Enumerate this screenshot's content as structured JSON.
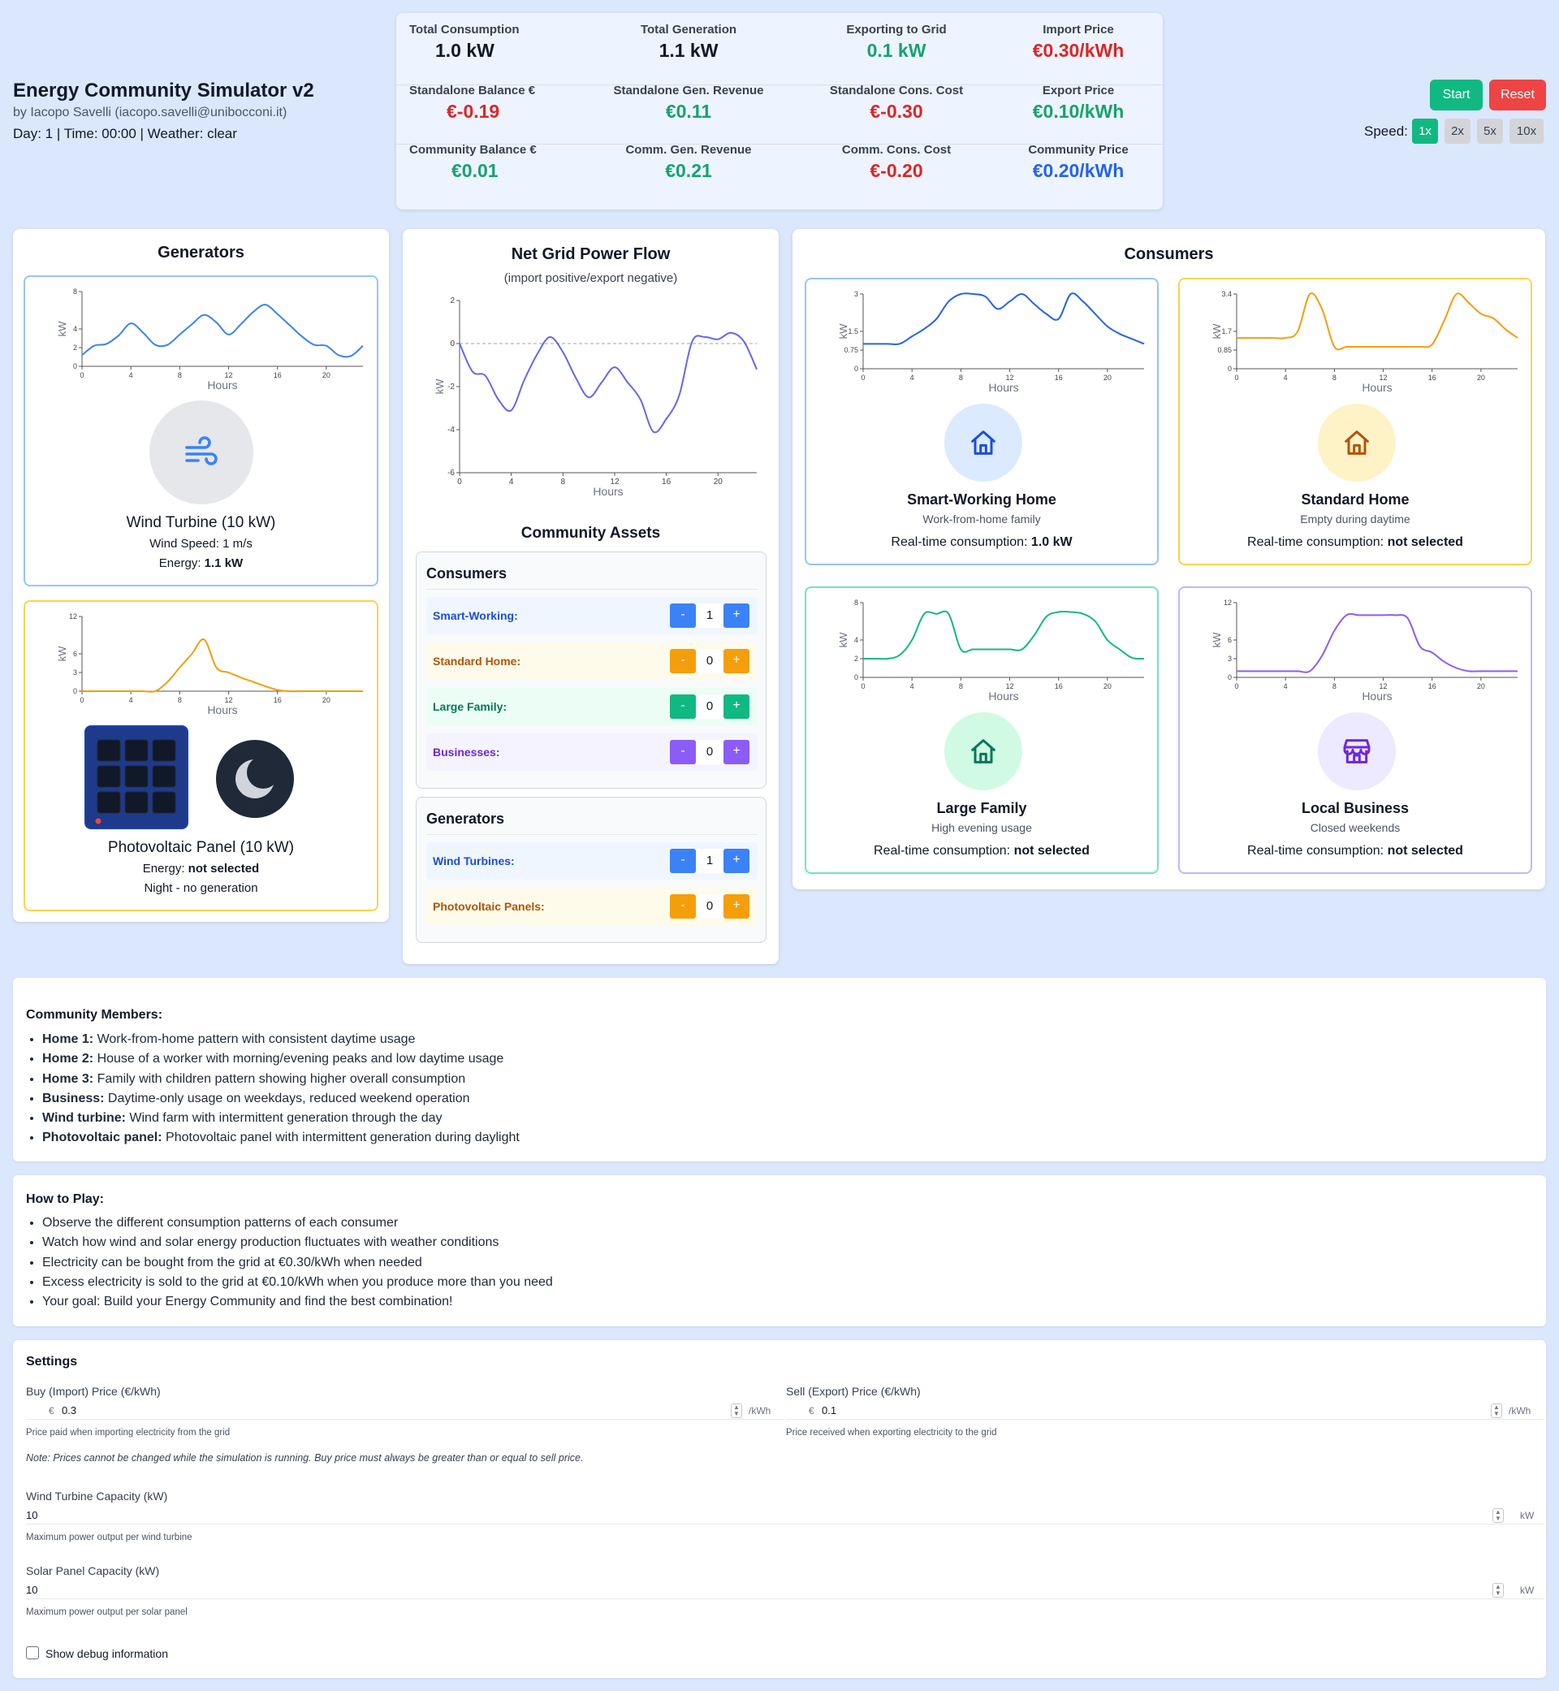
{
  "header": {
    "title": "Energy Community Simulator v2",
    "author": "by Iacopo Savelli (iacopo.savelli@unibocconi.it)",
    "status": "Day: 1 | Time: 00:00 | Weather: clear",
    "start_label": "Start",
    "reset_label": "Reset",
    "speed_label": "Speed:",
    "speeds": [
      "1x",
      "2x",
      "5x",
      "10x"
    ],
    "active_speed": "1x"
  },
  "stats": {
    "total_consumption": {
      "label": "Total Consumption",
      "value": "1.0 kW"
    },
    "total_generation": {
      "label": "Total Generation",
      "value": "1.1 kW"
    },
    "exporting": {
      "label": "Exporting to Grid",
      "value": "0.1 kW"
    },
    "import_price": {
      "label": "Import Price",
      "value": "€0.30/kWh"
    },
    "standalone_balance": {
      "label": "Standalone Balance €",
      "value": "€-0.19"
    },
    "standalone_gen_rev": {
      "label": "Standalone Gen. Revenue",
      "value": "€0.11"
    },
    "standalone_cons_cost": {
      "label": "Standalone Cons. Cost",
      "value": "€-0.30"
    },
    "export_price": {
      "label": "Export Price",
      "value": "€0.10/kWh"
    },
    "community_balance": {
      "label": "Community Balance €",
      "value": "€0.01"
    },
    "comm_gen_rev": {
      "label": "Comm. Gen. Revenue",
      "value": "€0.21"
    },
    "comm_cons_cost": {
      "label": "Comm. Cons. Cost",
      "value": "€-0.20"
    },
    "community_price": {
      "label": "Community Price",
      "value": "€0.20/kWh"
    }
  },
  "generators": {
    "title": "Generators",
    "wind": {
      "name": "Wind Turbine (10 kW)",
      "speed": "Wind Speed: 1 m/s",
      "energy_label": "Energy:",
      "energy_value": "1.1 kW"
    },
    "pv": {
      "name": "Photovoltaic Panel (10 kW)",
      "energy_label": "Energy:",
      "energy_value": "not selected",
      "note": "Night - no generation"
    }
  },
  "grid": {
    "title": "Net Grid Power Flow",
    "subtitle": "(import positive/export negative)"
  },
  "assets": {
    "title": "Community Assets",
    "consumers_title": "Consumers",
    "consumers": [
      {
        "label": "Smart-Working:",
        "count": "1",
        "color": "#3b82f6",
        "bg": "#eff6ff",
        "text": "#1d4ed8"
      },
      {
        "label": "Standard Home:",
        "count": "0",
        "color": "#f59e0b",
        "bg": "#fffbeb",
        "text": "#b45309"
      },
      {
        "label": "Large Family:",
        "count": "0",
        "color": "#10b981",
        "bg": "#ecfdf5",
        "text": "#047857"
      },
      {
        "label": "Businesses:",
        "count": "0",
        "color": "#8b5cf6",
        "bg": "#f5f3ff",
        "text": "#6d28d9"
      }
    ],
    "generators_title": "Generators",
    "generators": [
      {
        "label": "Wind Turbines:",
        "count": "1",
        "color": "#3b82f6",
        "bg": "#eff6ff",
        "text": "#1d4ed8"
      },
      {
        "label": "Photovoltaic Panels:",
        "count": "0",
        "color": "#f59e0b",
        "bg": "#fffbeb",
        "text": "#b45309"
      }
    ],
    "minus": "-",
    "plus": "+"
  },
  "consumers": {
    "title": "Consumers",
    "real_label": "Real-time consumption:",
    "cards": [
      {
        "name": "Smart-Working Home",
        "desc": "Work-from-home family",
        "value": "1.0 kW",
        "icon": "home-icon"
      },
      {
        "name": "Standard Home",
        "desc": "Empty during daytime",
        "value": "not selected",
        "icon": "home-icon"
      },
      {
        "name": "Large Family",
        "desc": "High evening usage",
        "value": "not selected",
        "icon": "home-icon"
      },
      {
        "name": "Local Business",
        "desc": "Closed weekends",
        "value": "not selected",
        "icon": "store-icon"
      }
    ]
  },
  "members": {
    "title": "Community Members:",
    "items": [
      {
        "k": "Home 1:",
        "v": " Work-from-home pattern with consistent daytime usage"
      },
      {
        "k": "Home 2:",
        "v": " House of a worker with morning/evening peaks and low daytime usage"
      },
      {
        "k": "Home 3:",
        "v": " Family with children pattern showing higher overall consumption"
      },
      {
        "k": "Business:",
        "v": " Daytime-only usage on weekdays, reduced weekend operation"
      },
      {
        "k": "Wind turbine:",
        "v": " Wind farm with intermittent generation through the day"
      },
      {
        "k": "Photovoltaic panel:",
        "v": " Photovoltaic panel with intermittent generation during daylight"
      }
    ]
  },
  "howto": {
    "title": "How to Play:",
    "items": [
      "Observe the different consumption patterns of each consumer",
      "Watch how wind and solar energy production fluctuates with weather conditions",
      "Electricity can be bought from the grid at €0.30/kWh when needed",
      "Excess electricity is sold to the grid at €0.10/kWh when you produce more than you need",
      "Your goal: Build your Energy Community and find the best combination!"
    ]
  },
  "settings": {
    "title": "Settings",
    "buy_label": "Buy (Import) Price (€/kWh)",
    "buy_value": "0.3",
    "buy_help": "Price paid when importing electricity from the grid",
    "sell_label": "Sell (Export) Price (€/kWh)",
    "sell_value": "0.1",
    "sell_help": "Price received when exporting electricity to the grid",
    "currency": "€",
    "unit_kwh": "/kWh",
    "note": "Note: Prices cannot be changed while the simulation is running. Buy price must always be greater than or equal to sell price.",
    "wind_label": "Wind Turbine Capacity (kW)",
    "wind_value": "10",
    "wind_help": "Maximum power output per wind turbine",
    "solar_label": "Solar Panel Capacity (kW)",
    "solar_value": "10",
    "solar_help": "Maximum power output per solar panel",
    "unit_kw": "kW",
    "debug_label": "Show debug information"
  },
  "chart_data": [
    {
      "id": "wind",
      "type": "line",
      "color": "#3b82f6",
      "ylabel": "kW",
      "xlabel": "Hours",
      "xlim": [
        0,
        23
      ],
      "ylim": [
        0,
        8
      ],
      "yticks": [
        0,
        2,
        4,
        8
      ],
      "xticks": [
        0,
        4,
        8,
        12,
        16,
        20
      ],
      "x": [
        0,
        1,
        2,
        3,
        4,
        5,
        6,
        7,
        8,
        9,
        10,
        11,
        12,
        13,
        14,
        15,
        16,
        17,
        18,
        19,
        20,
        21,
        22,
        23
      ],
      "y": [
        1.2,
        2.2,
        2.4,
        3.3,
        4.6,
        3.6,
        2.3,
        2.3,
        3.4,
        4.5,
        5.5,
        4.7,
        3.4,
        4.5,
        5.8,
        6.6,
        5.6,
        4.4,
        3.2,
        2.3,
        2.2,
        1.2,
        1.1,
        2.2
      ]
    },
    {
      "id": "pv",
      "type": "line",
      "color": "#f59e0b",
      "ylabel": "kW",
      "xlabel": "Hours",
      "xlim": [
        0,
        23
      ],
      "ylim": [
        0,
        12
      ],
      "yticks": [
        0,
        3,
        6,
        12
      ],
      "xticks": [
        0,
        4,
        8,
        12,
        16,
        20
      ],
      "x": [
        0,
        1,
        2,
        3,
        4,
        5,
        6,
        7,
        8,
        9,
        10,
        11,
        12,
        13,
        14,
        15,
        16,
        17,
        18,
        19,
        20,
        21,
        22,
        23
      ],
      "y": [
        0,
        0,
        0,
        0,
        0,
        0,
        0,
        1.5,
        3.8,
        6,
        8.3,
        3.8,
        3,
        2.2,
        1.5,
        0.8,
        0.2,
        0,
        0,
        0,
        0,
        0,
        0,
        0
      ]
    },
    {
      "id": "grid",
      "type": "line",
      "color": "#6366f1",
      "ylabel": "kW",
      "xlabel": "Hours",
      "xlim": [
        0,
        23
      ],
      "ylim": [
        -6,
        2
      ],
      "yticks": [
        -6,
        -4,
        -2,
        0,
        2
      ],
      "xticks": [
        0,
        4,
        8,
        12,
        16,
        20
      ],
      "zero_line": true,
      "x": [
        0,
        1,
        2,
        3,
        4,
        5,
        6,
        7,
        8,
        9,
        10,
        11,
        12,
        13,
        14,
        15,
        16,
        17,
        18,
        19,
        20,
        21,
        22,
        23
      ],
      "y": [
        0,
        -1.3,
        -1.5,
        -2.6,
        -3.1,
        -1.7,
        -0.5,
        0.3,
        -0.4,
        -1.6,
        -2.5,
        -1.8,
        -1.1,
        -1.8,
        -2.6,
        -4.1,
        -3.5,
        -2.4,
        0.1,
        0.3,
        0.2,
        0.5,
        0.1,
        -1.2
      ]
    },
    {
      "id": "smart",
      "type": "line",
      "color": "#2563eb",
      "ylabel": "kW",
      "xlabel": "Hours",
      "xlim": [
        0,
        23
      ],
      "ylim": [
        0,
        3
      ],
      "yticks": [
        0,
        0.75,
        1.5,
        3
      ],
      "xticks": [
        0,
        4,
        8,
        12,
        16,
        20
      ],
      "x": [
        0,
        1,
        2,
        3,
        4,
        5,
        6,
        7,
        8,
        9,
        10,
        11,
        12,
        13,
        14,
        15,
        16,
        17,
        18,
        19,
        20,
        21,
        22,
        23
      ],
      "y": [
        1,
        1,
        1,
        1,
        1.3,
        1.6,
        2,
        2.7,
        3,
        3,
        2.9,
        2.4,
        2.7,
        3,
        2.6,
        2.2,
        2,
        3,
        2.7,
        2.2,
        1.7,
        1.4,
        1.2,
        1
      ]
    },
    {
      "id": "standard",
      "type": "line",
      "color": "#f59e0b",
      "ylabel": "kW",
      "xlabel": "Hours",
      "xlim": [
        0,
        23
      ],
      "ylim": [
        0,
        3.4
      ],
      "yticks": [
        0,
        0.85,
        1.7,
        3.4
      ],
      "xticks": [
        0,
        4,
        8,
        12,
        16,
        20
      ],
      "x": [
        0,
        1,
        2,
        3,
        4,
        5,
        6,
        7,
        8,
        9,
        10,
        11,
        12,
        13,
        14,
        15,
        16,
        17,
        18,
        19,
        20,
        21,
        22,
        23
      ],
      "y": [
        1.4,
        1.4,
        1.4,
        1.4,
        1.4,
        1.7,
        3.4,
        2.7,
        1,
        1,
        1,
        1,
        1,
        1,
        1,
        1,
        1.1,
        2.2,
        3.4,
        3,
        2.5,
        2.3,
        1.8,
        1.4
      ]
    },
    {
      "id": "family",
      "type": "line",
      "color": "#10b981",
      "ylabel": "kW",
      "xlabel": "Hours",
      "xlim": [
        0,
        23
      ],
      "ylim": [
        0,
        8
      ],
      "yticks": [
        0,
        2,
        4,
        8
      ],
      "xticks": [
        0,
        4,
        8,
        12,
        16,
        20
      ],
      "x": [
        0,
        1,
        2,
        3,
        4,
        5,
        6,
        7,
        8,
        9,
        10,
        11,
        12,
        13,
        14,
        15,
        16,
        17,
        18,
        19,
        20,
        21,
        22,
        23
      ],
      "y": [
        2,
        2,
        2,
        2.4,
        4,
        6.8,
        6.8,
        6.8,
        3,
        3,
        3,
        3,
        3,
        3,
        4.5,
        6.5,
        7,
        7,
        6.8,
        6,
        4,
        3,
        2.1,
        2
      ]
    },
    {
      "id": "business",
      "type": "line",
      "color": "#8b5cf6",
      "ylabel": "kW",
      "xlabel": "Hours",
      "xlim": [
        0,
        23
      ],
      "ylim": [
        0,
        12
      ],
      "yticks": [
        0,
        3,
        6,
        12
      ],
      "xticks": [
        0,
        4,
        8,
        12,
        16,
        20
      ],
      "x": [
        0,
        1,
        2,
        3,
        4,
        5,
        6,
        7,
        8,
        9,
        10,
        11,
        12,
        13,
        14,
        15,
        16,
        17,
        18,
        19,
        20,
        21,
        22,
        23
      ],
      "y": [
        1,
        1,
        1,
        1,
        1,
        1,
        1,
        3.5,
        7.5,
        10,
        10,
        10,
        10,
        10,
        9.5,
        5,
        4,
        2.5,
        1.5,
        1,
        1,
        1,
        1,
        1
      ]
    }
  ]
}
